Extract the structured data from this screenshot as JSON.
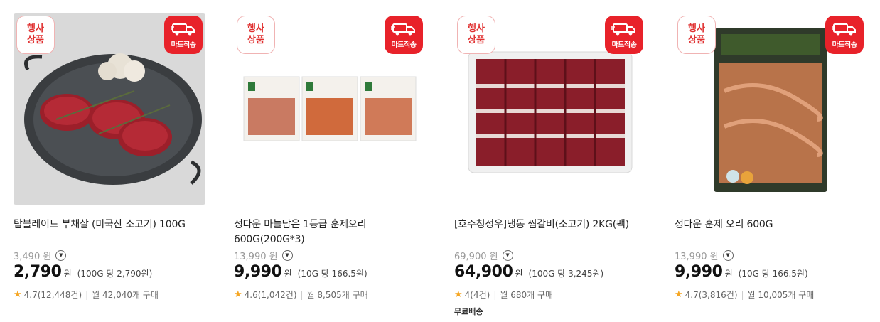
{
  "badges": {
    "event": "행사\n상품",
    "event_l1": "행사",
    "event_l2": "상품",
    "mart": "마트직송"
  },
  "products": [
    {
      "title": "탑블레이드 부채살 (미국산 소고기) 100G",
      "orig_price": "3,490 원",
      "price": "2,790",
      "won": "원",
      "unit_price": "(100G 당 2,790원)",
      "rating": "4.7(12,448건)",
      "purchases": "월 42,040개 구매",
      "extra": ""
    },
    {
      "title": "정다운 마늘담은 1등급 훈제오리 600G(200G*3)",
      "orig_price": "13,990 원",
      "price": "9,990",
      "won": "원",
      "unit_price": "(10G 당 166.5원)",
      "rating": "4.6(1,042건)",
      "purchases": "월 8,505개 구매",
      "extra": ""
    },
    {
      "title": "[호주청정우]냉동 찜갈비(소고기) 2KG(팩)",
      "orig_price": "69,900 원",
      "price": "64,900",
      "won": "원",
      "unit_price": "(100G 당 3,245원)",
      "rating": "4(4건)",
      "purchases": "월 680개 구매",
      "extra": "무료배송"
    },
    {
      "title": "정다운 훈제 오리 600G",
      "orig_price": "13,990 원",
      "price": "9,990",
      "won": "원",
      "unit_price": "(10G 당 166.5원)",
      "rating": "4.7(3,816건)",
      "purchases": "월 10,005개 구매",
      "extra": ""
    }
  ],
  "icons": {
    "truck": "truck-icon",
    "star": "star-icon",
    "chevron": "chevron-down-icon"
  },
  "colors": {
    "brand_red": "#e8222a",
    "star": "#f5a623"
  }
}
